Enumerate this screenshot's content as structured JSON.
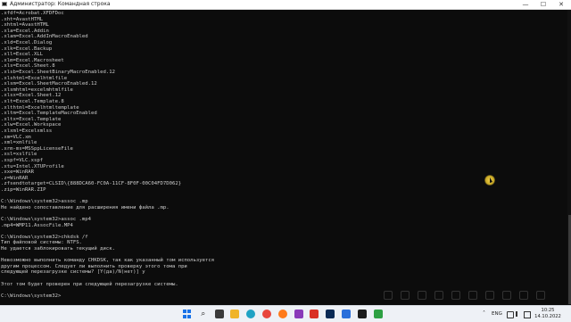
{
  "window": {
    "title": "Администратор: Командная строка",
    "controls": [
      "—",
      "☐",
      "✕"
    ]
  },
  "console": {
    "lines": [
      ".xfdf=Acrobat.XFDFDoc",
      ".xht=AvastHTML",
      ".xhtml=AvastHTML",
      ".xla=Excel.Addin",
      ".xlam=Excel.AddInMacroEnabled",
      ".xld=Excel.Dialog",
      ".xlk=Excel.Backup",
      ".xll=Excel.XLL",
      ".xlm=Excel.Macrosheet",
      ".xls=Excel.Sheet.8",
      ".xlsb=Excel.SheetBinaryMacroEnabled.12",
      ".xlshtml=Excelhtmlfile",
      ".xlsm=Excel.SheetMacroEnabled.12",
      ".xlsmhtml=excelmhtmlfile",
      ".xlsx=Excel.Sheet.12",
      ".xlt=Excel.Template.8",
      ".xlthtml=Excelhtmltemplate",
      ".xltm=Excel.TemplateMacroEnabled",
      ".xltx=Excel.Template",
      ".xlw=Excel.Workspace",
      ".xlxml=Excelxmlss",
      ".xm=VLC.xm",
      ".xml=xmlfile",
      ".xrm-ms=MSSppLicenseFile",
      ".xsl=xslfile",
      ".xspf=VLC.xspf",
      ".xtu=Intel.XTUProfile",
      ".xxe=WinRAR",
      ".z=WinRAR",
      ".zfsendtotarget=CLSID\\{888DCA60-FC0A-11CF-8F0F-00C04FD7D062}",
      ".zip=WinRAR.ZIP",
      "",
      "C:\\Windows\\system32>assoc .mp",
      "Не найдено сопоставление для расширения имени файла .mp.",
      "",
      "C:\\Windows\\system32>assoc .mp4",
      ".mp4=WMP11.AssocFile.MP4",
      "",
      "C:\\Windows\\system32>chkdsk /f",
      "Тип файловой системы: NTFS.",
      "Не удается заблокировать текущий диск.",
      "",
      "Невозможно выполнить команду CHKDSK, так как указанный том используется",
      "другим процессом. Следует ли выполнить проверку этого тома при",
      "следующей перезагрузке системы? [Y(да)/N(нет)] y",
      "",
      "Этот том будет проверен при следующей перезагрузке системы.",
      "",
      "C:\\Windows\\system32>"
    ]
  },
  "taskbar": {
    "icons": [
      {
        "name": "start-icon",
        "color": "#1a73e8"
      },
      {
        "name": "search-icon",
        "color": "#222222"
      },
      {
        "name": "task-view-icon",
        "color": "#3a3a3a"
      },
      {
        "name": "file-explorer-icon",
        "color": "#f0b429"
      },
      {
        "name": "edge-icon",
        "color": "#1fa2c4"
      },
      {
        "name": "chrome-icon",
        "color": "#e8453c"
      },
      {
        "name": "firefox-icon",
        "color": "#ff7a1a"
      },
      {
        "name": "photo-editor-icon",
        "color": "#8a3ab9"
      },
      {
        "name": "mail-icon",
        "color": "#d93025"
      },
      {
        "name": "photoshop-icon",
        "color": "#0a2a55"
      },
      {
        "name": "app-icon",
        "color": "#2a6fdb"
      },
      {
        "name": "command-prompt-icon",
        "color": "#1c1c1c"
      },
      {
        "name": "video-editor-icon",
        "color": "#2ea043"
      }
    ],
    "tray": {
      "language": "ENG",
      "time": "10:25",
      "date": "14.10.2022"
    }
  }
}
